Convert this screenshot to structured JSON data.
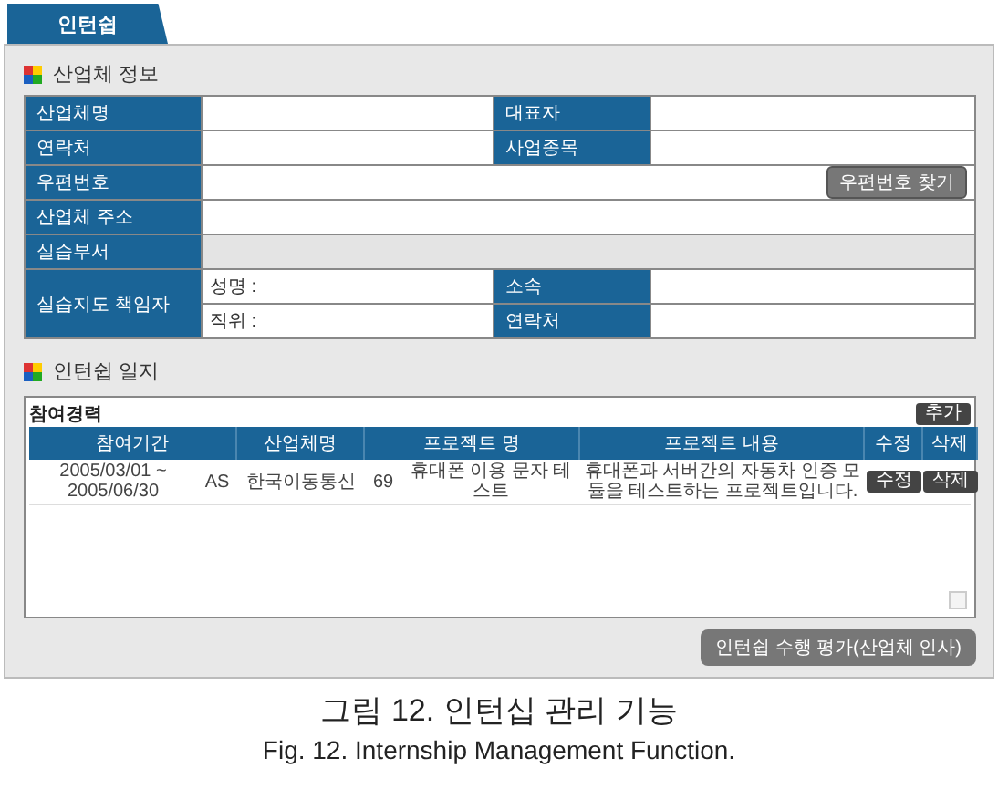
{
  "tabs": [
    {
      "label": "인턴쉽",
      "selected": true
    }
  ],
  "company_info": {
    "title": "산업체 정보",
    "rows": [
      {
        "kind": "pair",
        "label": "산업체명",
        "label_2": "대표자"
      },
      {
        "kind": "pair",
        "label": "연락처",
        "label_2": "사업종목"
      },
      {
        "kind": "wide",
        "label": "우편번호",
        "button": "우편번호 찾기",
        "disabled": false
      },
      {
        "kind": "wide",
        "label": "산업체 주소",
        "disabled": false
      },
      {
        "kind": "wide",
        "label": "실습부서",
        "disabled": true
      },
      {
        "kind": "supervisor",
        "label": "실습지도 책임자",
        "lines": [
          {
            "field_label": "성명 :",
            "label_2": "소속"
          },
          {
            "field_label": "직위 :",
            "label_2": "연락처"
          }
        ]
      }
    ]
  },
  "journal": {
    "title": "인턴쉽 일지",
    "list_title": "참여경력",
    "add_button": "추가",
    "columns": [
      "참여기간",
      "산업체명",
      "프로젝트 명",
      "프로젝트 내용",
      "수정",
      "삭제"
    ],
    "rows": [
      {
        "period": "2005/03/01 ~ 2005/06/30",
        "code": "AS",
        "company": "한국이동통신",
        "number": "69",
        "project": "휴대폰 이용 문자 테스트",
        "content": "휴대폰과 서버간의 자동차 인증 모듈을 테스트하는 프로젝트입니다.",
        "edit": "수정",
        "delete": "삭제"
      }
    ],
    "footer_button": "인턴쉽 수행 평가(산업체 인사)"
  },
  "caption": {
    "korean": "그림 12. 인턴십 관리 기능",
    "english": "Fig. 12. Internship Management Function."
  }
}
